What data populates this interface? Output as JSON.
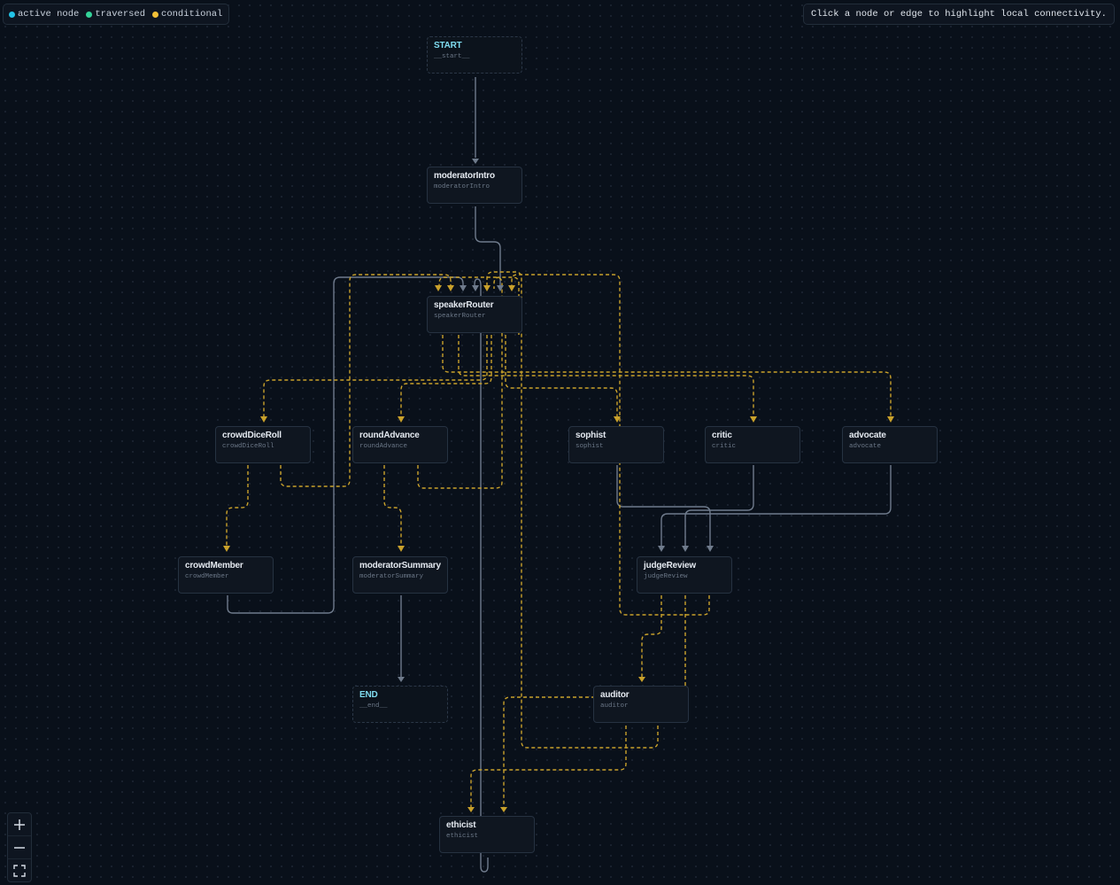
{
  "legend": {
    "items": [
      {
        "label": "active node",
        "color": "#22c3e6"
      },
      {
        "label": "traversed",
        "color": "#34d399"
      },
      {
        "label": "conditional",
        "color": "#f2c037"
      }
    ]
  },
  "hint": "Click a node or edge to highlight local connectivity.",
  "colors": {
    "edge": "#6f7b8c",
    "conditional": "#c9a12b",
    "terminal_title": "#7fdcf0"
  },
  "nodes": {
    "start": {
      "title": "START",
      "id": "__start__"
    },
    "moderatorIntro": {
      "title": "moderatorIntro",
      "id": "moderatorIntro"
    },
    "speakerRouter": {
      "title": "speakerRouter",
      "id": "speakerRouter"
    },
    "crowdDiceRoll": {
      "title": "crowdDiceRoll",
      "id": "crowdDiceRoll"
    },
    "roundAdvance": {
      "title": "roundAdvance",
      "id": "roundAdvance"
    },
    "sophist": {
      "title": "sophist",
      "id": "sophist"
    },
    "critic": {
      "title": "critic",
      "id": "critic"
    },
    "advocate": {
      "title": "advocate",
      "id": "advocate"
    },
    "crowdMember": {
      "title": "crowdMember",
      "id": "crowdMember"
    },
    "moderatorSummary": {
      "title": "moderatorSummary",
      "id": "moderatorSummary"
    },
    "judgeReview": {
      "title": "judgeReview",
      "id": "judgeReview"
    },
    "end": {
      "title": "END",
      "id": "__end__"
    },
    "auditor": {
      "title": "auditor",
      "id": "auditor"
    },
    "ethicist": {
      "title": "ethicist",
      "id": "ethicist"
    }
  },
  "edges": [
    {
      "from": "__start__",
      "to": "moderatorIntro",
      "conditional": false
    },
    {
      "from": "moderatorIntro",
      "to": "speakerRouter",
      "conditional": false
    },
    {
      "from": "speakerRouter",
      "to": "crowdDiceRoll",
      "conditional": true
    },
    {
      "from": "speakerRouter",
      "to": "roundAdvance",
      "conditional": true
    },
    {
      "from": "speakerRouter",
      "to": "sophist",
      "conditional": true
    },
    {
      "from": "speakerRouter",
      "to": "critic",
      "conditional": true
    },
    {
      "from": "speakerRouter",
      "to": "advocate",
      "conditional": true
    },
    {
      "from": "speakerRouter",
      "to": "ethicist",
      "conditional": true
    },
    {
      "from": "crowdDiceRoll",
      "to": "crowdMember",
      "conditional": true
    },
    {
      "from": "crowdDiceRoll",
      "to": "speakerRouter",
      "conditional": true
    },
    {
      "from": "crowdMember",
      "to": "speakerRouter",
      "conditional": false
    },
    {
      "from": "roundAdvance",
      "to": "moderatorSummary",
      "conditional": true
    },
    {
      "from": "roundAdvance",
      "to": "speakerRouter",
      "conditional": true
    },
    {
      "from": "moderatorSummary",
      "to": "__end__",
      "conditional": false
    },
    {
      "from": "sophist",
      "to": "judgeReview",
      "conditional": false
    },
    {
      "from": "critic",
      "to": "judgeReview",
      "conditional": false
    },
    {
      "from": "advocate",
      "to": "judgeReview",
      "conditional": false
    },
    {
      "from": "judgeReview",
      "to": "auditor",
      "conditional": true
    },
    {
      "from": "judgeReview",
      "to": "speakerRouter",
      "conditional": true
    },
    {
      "from": "judgeReview",
      "to": "ethicist",
      "conditional": true
    },
    {
      "from": "auditor",
      "to": "ethicist",
      "conditional": true
    },
    {
      "from": "auditor",
      "to": "speakerRouter",
      "conditional": true
    },
    {
      "from": "ethicist",
      "to": "speakerRouter",
      "conditional": false
    }
  ],
  "controls": {
    "zoom_in": "zoom-in-icon",
    "zoom_out": "zoom-out-icon",
    "fit_view": "fit-view-icon"
  }
}
